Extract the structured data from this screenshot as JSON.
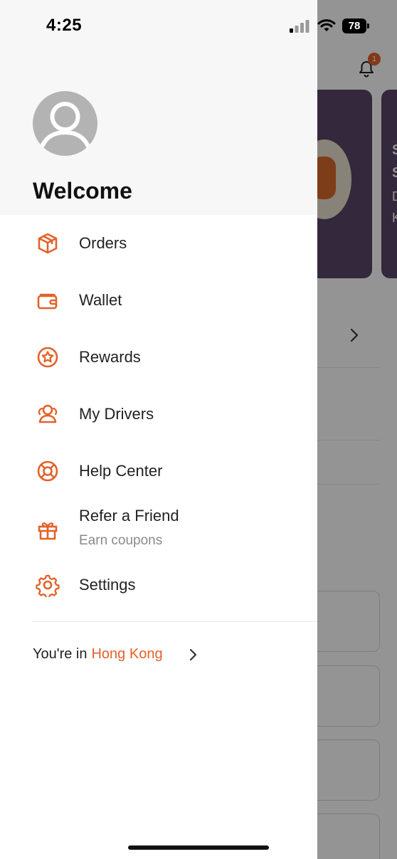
{
  "status_bar": {
    "time": "4:25",
    "battery": "78",
    "signal_icon": "cellular-signal-icon",
    "wifi_icon": "wifi-icon",
    "battery_icon": "battery-icon"
  },
  "background": {
    "notification_badge": "1",
    "banner_letters": [
      "S",
      "S",
      "D",
      "K"
    ]
  },
  "drawer": {
    "welcome": "Welcome",
    "menu": [
      {
        "label": "Orders",
        "icon": "package-box-icon"
      },
      {
        "label": "Wallet",
        "icon": "wallet-icon"
      },
      {
        "label": "Rewards",
        "icon": "star-badge-icon"
      },
      {
        "label": "My Drivers",
        "icon": "drivers-people-icon"
      },
      {
        "label": "Help Center",
        "icon": "lifebuoy-icon"
      },
      {
        "label": "Refer a Friend",
        "sublabel": "Earn coupons",
        "icon": "gift-icon"
      },
      {
        "label": "Settings",
        "icon": "gear-icon"
      }
    ],
    "region": {
      "prefix": "You're in",
      "city": "Hong Kong"
    }
  },
  "colors": {
    "accent": "#e2622a",
    "overlay": "rgba(0,0,0,0.42)",
    "banner_bg": "#5b4668"
  }
}
